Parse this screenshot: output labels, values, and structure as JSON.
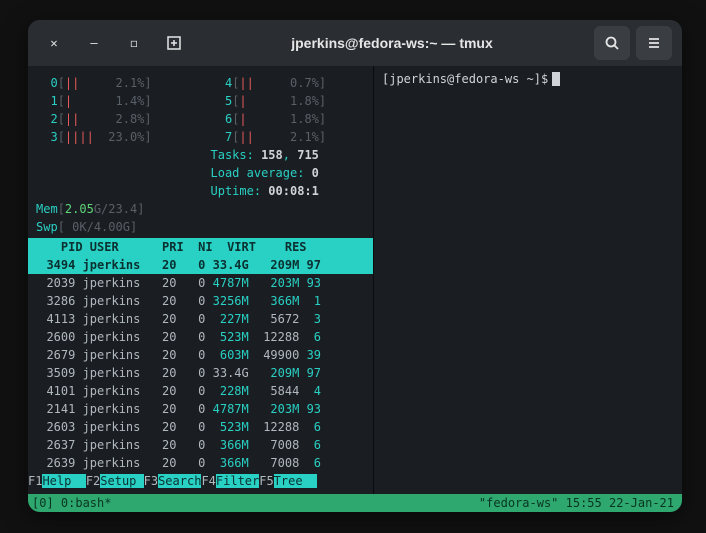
{
  "window": {
    "title": "jperkins@fedora-ws:~ — tmux"
  },
  "right_pane": {
    "prompt_user": "jperkins",
    "prompt_host": "fedora-ws",
    "prompt_dir": "~"
  },
  "cpu": {
    "left": [
      {
        "id": "0",
        "bars": "||",
        "pct": "2.1%"
      },
      {
        "id": "1",
        "bars": "|",
        "pct": "1.4%"
      },
      {
        "id": "2",
        "bars": "||",
        "pct": "2.8%"
      },
      {
        "id": "3",
        "bars": "||||",
        "pct": "23.0%"
      }
    ],
    "right": [
      {
        "id": "4",
        "bars": "||",
        "pct": "0.7%"
      },
      {
        "id": "5",
        "bars": "|",
        "pct": "1.8%"
      },
      {
        "id": "6",
        "bars": "|",
        "pct": "1.8%"
      },
      {
        "id": "7",
        "bars": "||",
        "pct": "2.1%"
      }
    ]
  },
  "mem": {
    "label": "Mem",
    "used": "2.05",
    "sep": "G/23.4",
    "close": "]"
  },
  "swp": {
    "label": "Swp",
    "val": "0K/4.00G"
  },
  "tasks": {
    "label": "Tasks: ",
    "n1": "158",
    "sep": ", ",
    "n2": "715"
  },
  "load": {
    "label": "Load average: ",
    "val": "0"
  },
  "uptime": {
    "label": "Uptime: ",
    "val": "00:08:1"
  },
  "proc": {
    "headers": [
      "PID",
      "USER",
      "PRI",
      "NI",
      "VIRT",
      "RES"
    ],
    "extra_head": "",
    "rows": [
      {
        "pid": "3494",
        "user": "jperkins",
        "pri": "20",
        "ni": "0",
        "virt": "33.4G",
        "virt_hl": false,
        "res": "209M",
        "res2": "97",
        "sel": true
      },
      {
        "pid": "2039",
        "user": "jperkins",
        "pri": "20",
        "ni": "0",
        "virt": "4787M",
        "virt_hl": true,
        "res": "203M",
        "res2": "93"
      },
      {
        "pid": "3286",
        "user": "jperkins",
        "pri": "20",
        "ni": "0",
        "virt": "3256M",
        "virt_hl": true,
        "res": "366M",
        "res2": "1"
      },
      {
        "pid": "4113",
        "user": "jperkins",
        "pri": "20",
        "ni": "0",
        "virt": "227M",
        "virt_hl": true,
        "res": "5672",
        "res_tail": "",
        "res2": "3"
      },
      {
        "pid": "2600",
        "user": "jperkins",
        "pri": "20",
        "ni": "0",
        "virt": "523M",
        "virt_hl": true,
        "res": "12288",
        "res2": "6"
      },
      {
        "pid": "2679",
        "user": "jperkins",
        "pri": "20",
        "ni": "0",
        "virt": "603M",
        "virt_hl": true,
        "res": "49900",
        "res2": "39"
      },
      {
        "pid": "3509",
        "user": "jperkins",
        "pri": "20",
        "ni": "0",
        "virt": "33.4G",
        "virt_hl": false,
        "res": "209M",
        "res2": "97"
      },
      {
        "pid": "4101",
        "user": "jperkins",
        "pri": "20",
        "ni": "0",
        "virt": "228M",
        "virt_hl": true,
        "res": "5844",
        "res2": "4"
      },
      {
        "pid": "2141",
        "user": "jperkins",
        "pri": "20",
        "ni": "0",
        "virt": "4787M",
        "virt_hl": true,
        "res": "203M",
        "res2": "93"
      },
      {
        "pid": "2603",
        "user": "jperkins",
        "pri": "20",
        "ni": "0",
        "virt": "523M",
        "virt_hl": true,
        "res": "12288",
        "res2": "6"
      },
      {
        "pid": "2637",
        "user": "jperkins",
        "pri": "20",
        "ni": "0",
        "virt": "366M",
        "virt_hl": true,
        "res": "7008",
        "res2": "6"
      },
      {
        "pid": "2639",
        "user": "jperkins",
        "pri": "20",
        "ni": "0",
        "virt": "366M",
        "virt_hl": true,
        "res": "7008",
        "res2": "6"
      }
    ]
  },
  "fn": [
    {
      "key": "F1",
      "label": "Help"
    },
    {
      "key": "F2",
      "label": "Setup"
    },
    {
      "key": "F3",
      "label": "Search"
    },
    {
      "key": "F4",
      "label": "Filter"
    },
    {
      "key": "F5",
      "label": "Tree"
    }
  ],
  "status": {
    "left": "[0] 0:bash*",
    "right": "\"fedora-ws\" 15:55 22-Jan-21"
  }
}
